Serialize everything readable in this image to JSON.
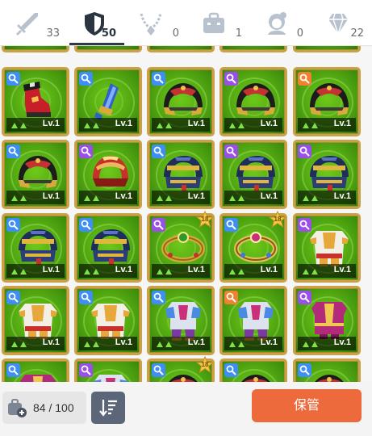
{
  "tabs": [
    {
      "name": "weapon",
      "icon": "sword-icon",
      "count": "33",
      "active": false
    },
    {
      "name": "armor",
      "icon": "shield-icon",
      "count": "50",
      "active": true
    },
    {
      "name": "necklace",
      "icon": "necklace-icon",
      "count": "0",
      "active": false
    },
    {
      "name": "bag",
      "icon": "briefcase-icon",
      "count": "1",
      "active": false
    },
    {
      "name": "character",
      "icon": "portrait-icon",
      "count": "0",
      "active": false
    },
    {
      "name": "gem",
      "icon": "diamond-icon",
      "count": "22",
      "active": false
    }
  ],
  "grid": {
    "level_label": "Lv.1",
    "rows": [
      [
        {
          "item": "boot",
          "badge": "blue"
        },
        {
          "item": "gauntlet",
          "badge": "blue"
        },
        {
          "item": "helmet-black",
          "badge": "blue"
        },
        {
          "item": "helmet-black",
          "badge": "purple"
        },
        {
          "item": "helmet-black",
          "badge": "orange"
        }
      ],
      [
        {
          "item": "helmet-black",
          "badge": "blue"
        },
        {
          "item": "helmet-red",
          "badge": "purple"
        },
        {
          "item": "helmet-navy",
          "badge": "blue"
        },
        {
          "item": "helmet-navy",
          "badge": "purple"
        },
        {
          "item": "helmet-navy",
          "badge": "purple"
        }
      ],
      [
        {
          "item": "helmet-navy",
          "badge": "blue"
        },
        {
          "item": "helmet-navy",
          "badge": "blue"
        },
        {
          "item": "ring-green",
          "badge": "purple",
          "star": "18"
        },
        {
          "item": "ring-gold",
          "badge": "blue",
          "star": "18"
        },
        {
          "item": "armor-white",
          "badge": "purple"
        }
      ],
      [
        {
          "item": "armor-white",
          "badge": "blue"
        },
        {
          "item": "armor-white",
          "badge": "blue"
        },
        {
          "item": "armor-knight",
          "badge": "blue"
        },
        {
          "item": "armor-knight",
          "badge": "orange"
        },
        {
          "item": "robe-pink",
          "badge": "purple"
        }
      ],
      [
        {
          "item": "robe-pink",
          "badge": "blue"
        },
        {
          "item": "armor-knight",
          "badge": "purple"
        },
        {
          "item": "helmet-black",
          "badge": "blue",
          "star": "18"
        },
        {
          "item": "helmet-black",
          "badge": "blue"
        },
        {
          "item": "helmet-black",
          "badge": "blue"
        }
      ]
    ]
  },
  "colors": {
    "blue": "#3d8ef5",
    "purple": "#9a4fe6",
    "orange": "#f0812f",
    "accent": "#ec6a3b",
    "tab_active": "#2f3a47"
  },
  "bottom": {
    "capacity_icon": "bag-plus-icon",
    "capacity_text": "84 / 100",
    "sort_icon": "sort-icon",
    "store_label": "保管"
  }
}
